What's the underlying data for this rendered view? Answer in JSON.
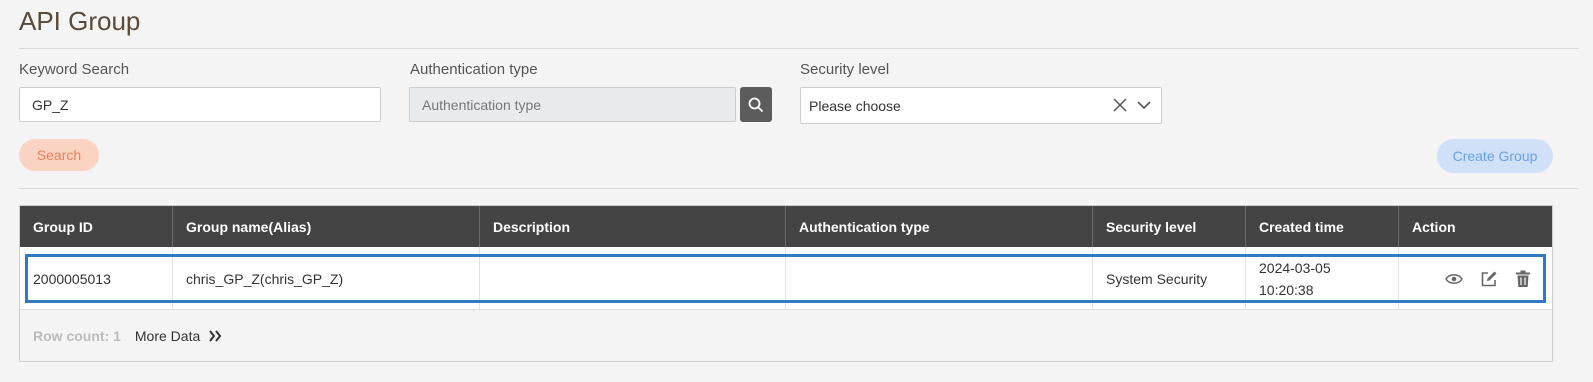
{
  "page": {
    "title": "API Group"
  },
  "filters": {
    "keyword_label": "Keyword Search",
    "keyword_value": "GP_Z",
    "auth_label": "Authentication type",
    "auth_placeholder": "Authentication type",
    "security_label": "Security level",
    "security_placeholder": "Please choose"
  },
  "buttons": {
    "search": "Search",
    "create_group": "Create Group"
  },
  "table": {
    "columns": [
      "Group ID",
      "Group name(Alias)",
      "Description",
      "Authentication type",
      "Security level",
      "Created time",
      "Action"
    ],
    "rows": [
      {
        "group_id": "2000005013",
        "group_name": "chris_GP_Z(chris_GP_Z)",
        "description": "",
        "auth_type": "",
        "security_level": "System Security",
        "created_date": "2024-03-05",
        "created_time": "10:20:38"
      }
    ],
    "footer": {
      "row_count": "Row count: 1",
      "more_data": "More Data"
    }
  },
  "icons": [
    "search-icon",
    "clear-icon",
    "chevron-down-icon",
    "view-icon",
    "edit-icon",
    "delete-icon",
    "double-chevron-right-icon"
  ],
  "colors": {
    "header_bg": "#444444",
    "accent_blue": "#2e7bc4",
    "search_btn": "#fbd3c3",
    "create_btn": "#cfe0f7"
  }
}
